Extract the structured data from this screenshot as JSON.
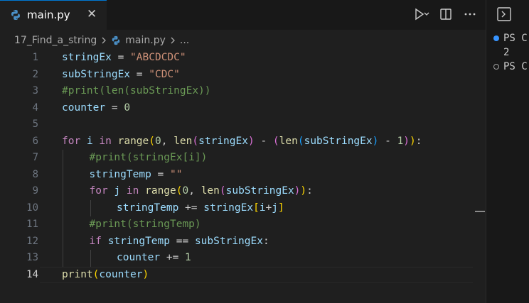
{
  "tab": {
    "filename": "main.py",
    "close_glyph": "✕"
  },
  "breadcrumb": {
    "folder": "17_Find_a_string",
    "file": "main.py",
    "more": "..."
  },
  "colors": {
    "keyword": "#c586c0",
    "function": "#dcdcaa",
    "variable": "#9cdcfe",
    "string": "#ce9178",
    "number": "#b5cea8",
    "comment": "#6a9955",
    "text": "#cccccc",
    "bracket1": "#ffd700",
    "bracket2": "#da70d6",
    "bracket3": "#179fff"
  },
  "editor": {
    "active_line": 14,
    "lines": [
      {
        "n": "1",
        "tokens": [
          [
            "stringEx",
            "variable"
          ],
          [
            " = ",
            "text"
          ],
          [
            "\"ABCDCDC\"",
            "string"
          ]
        ]
      },
      {
        "n": "2",
        "tokens": [
          [
            "subStringEx",
            "variable"
          ],
          [
            " = ",
            "text"
          ],
          [
            "\"CDC\"",
            "string"
          ]
        ]
      },
      {
        "n": "3",
        "tokens": [
          [
            "#print(len(subStringEx))",
            "comment"
          ]
        ]
      },
      {
        "n": "4",
        "tokens": [
          [
            "counter",
            "variable"
          ],
          [
            " = ",
            "text"
          ],
          [
            "0",
            "number"
          ]
        ]
      },
      {
        "n": "5",
        "tokens": []
      },
      {
        "n": "6",
        "tokens": [
          [
            "for",
            "keyword"
          ],
          [
            " ",
            "text"
          ],
          [
            "i",
            "variable"
          ],
          [
            " ",
            "text"
          ],
          [
            "in",
            "keyword"
          ],
          [
            " ",
            "text"
          ],
          [
            "range",
            "function"
          ],
          [
            "(",
            "bracket1"
          ],
          [
            "0",
            "number"
          ],
          [
            ", ",
            "text"
          ],
          [
            "len",
            "function"
          ],
          [
            "(",
            "bracket2"
          ],
          [
            "stringEx",
            "variable"
          ],
          [
            ")",
            "bracket2"
          ],
          [
            " - ",
            "text"
          ],
          [
            "(",
            "bracket2"
          ],
          [
            "len",
            "function"
          ],
          [
            "(",
            "bracket3"
          ],
          [
            "subStringEx",
            "variable"
          ],
          [
            ")",
            "bracket3"
          ],
          [
            " - ",
            "text"
          ],
          [
            "1",
            "number"
          ],
          [
            ")",
            "bracket2"
          ],
          [
            ")",
            "bracket1"
          ],
          [
            ":",
            "text"
          ]
        ]
      },
      {
        "n": "7",
        "indent": 1,
        "tokens": [
          [
            "#print(stringEx[i])",
            "comment"
          ]
        ]
      },
      {
        "n": "8",
        "indent": 1,
        "tokens": [
          [
            "stringTemp",
            "variable"
          ],
          [
            " = ",
            "text"
          ],
          [
            "\"\"",
            "string"
          ]
        ]
      },
      {
        "n": "9",
        "indent": 1,
        "tokens": [
          [
            "for",
            "keyword"
          ],
          [
            " ",
            "text"
          ],
          [
            "j",
            "variable"
          ],
          [
            " ",
            "text"
          ],
          [
            "in",
            "keyword"
          ],
          [
            " ",
            "text"
          ],
          [
            "range",
            "function"
          ],
          [
            "(",
            "bracket1"
          ],
          [
            "0",
            "number"
          ],
          [
            ", ",
            "text"
          ],
          [
            "len",
            "function"
          ],
          [
            "(",
            "bracket2"
          ],
          [
            "subStringEx",
            "variable"
          ],
          [
            ")",
            "bracket2"
          ],
          [
            ")",
            "bracket1"
          ],
          [
            ":",
            "text"
          ]
        ]
      },
      {
        "n": "10",
        "indent": 2,
        "tokens": [
          [
            "stringTemp",
            "variable"
          ],
          [
            " += ",
            "text"
          ],
          [
            "stringEx",
            "variable"
          ],
          [
            "[",
            "bracket1"
          ],
          [
            "i",
            "variable"
          ],
          [
            "+",
            "text"
          ],
          [
            "j",
            "variable"
          ],
          [
            "]",
            "bracket1"
          ]
        ]
      },
      {
        "n": "11",
        "indent": 1,
        "tokens": [
          [
            "#print(stringTemp)",
            "comment"
          ]
        ]
      },
      {
        "n": "12",
        "indent": 1,
        "tokens": [
          [
            "if",
            "keyword"
          ],
          [
            " ",
            "text"
          ],
          [
            "stringTemp",
            "variable"
          ],
          [
            " == ",
            "text"
          ],
          [
            "subStringEx",
            "variable"
          ],
          [
            ":",
            "text"
          ]
        ]
      },
      {
        "n": "13",
        "indent": 2,
        "tokens": [
          [
            "counter",
            "variable"
          ],
          [
            " += ",
            "text"
          ],
          [
            "1",
            "number"
          ]
        ]
      },
      {
        "n": "14",
        "tokens": [
          [
            "print",
            "function"
          ],
          [
            "(",
            "bracket1"
          ],
          [
            "counter",
            "variable"
          ],
          [
            ")",
            "bracket1"
          ]
        ]
      }
    ]
  },
  "terminal": {
    "lines": [
      {
        "text": "PS C",
        "marker": "filled"
      },
      {
        "text": "2",
        "marker": "none"
      },
      {
        "text": "PS C",
        "marker": "hollow"
      }
    ]
  }
}
